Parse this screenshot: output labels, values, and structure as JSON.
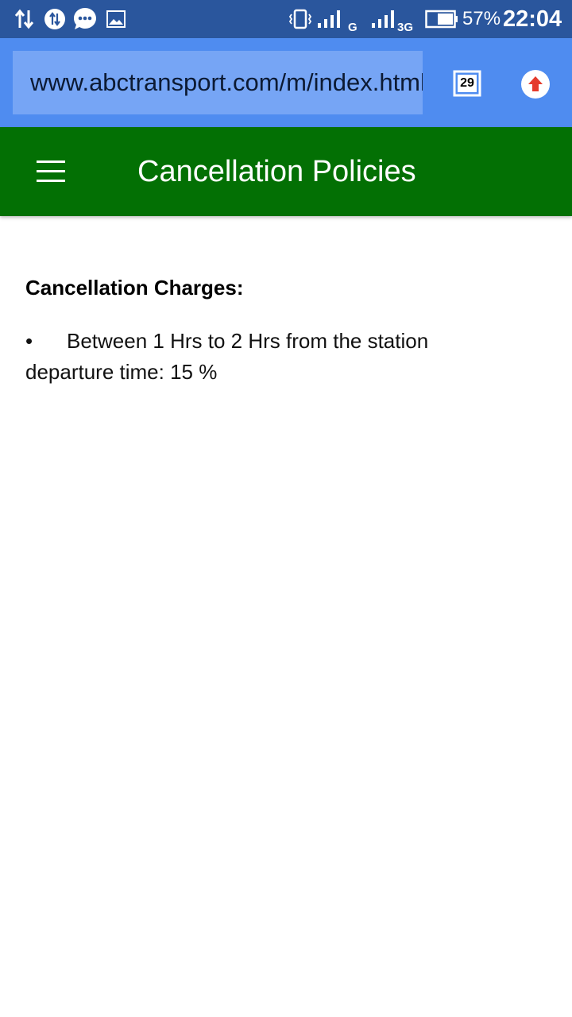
{
  "status_bar": {
    "battery": "57%",
    "time": "22:04",
    "network_1": "G",
    "network_2": "3G",
    "icons": [
      "data-transfer-icon",
      "data-saver-icon",
      "messaging-icon",
      "gallery-icon",
      "vibrate-icon",
      "signal-icon",
      "battery-icon"
    ]
  },
  "browser": {
    "url": "www.abctransport.com/m/index.html",
    "tab_count": "29",
    "upload_icon": "upload-icon"
  },
  "app_bar": {
    "title": "Cancellation Policies",
    "menu_icon": "hamburger-menu-icon",
    "color": "#037004"
  },
  "content": {
    "heading": "Cancellation Charges:",
    "items": [
      {
        "bullet": "•",
        "text": "Between 1 Hrs to 2 Hrs from the station departure time: 15 %"
      }
    ]
  }
}
